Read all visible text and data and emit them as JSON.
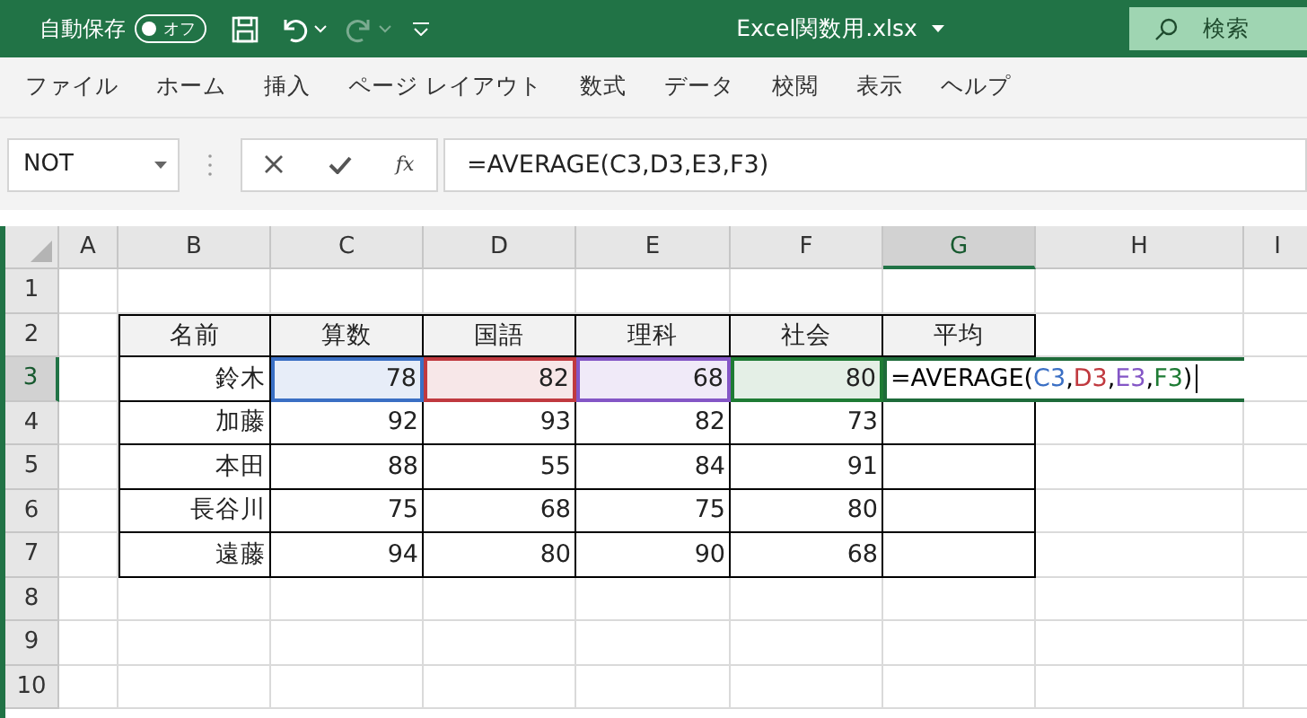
{
  "title_bar": {
    "autosave_label": "自動保存",
    "autosave_toggle": {
      "label": "オフ",
      "on": false
    },
    "redo_disabled": true,
    "file_name": "Excel関数用.xlsx",
    "search": {
      "placeholder": "検索"
    }
  },
  "menu": [
    "ファイル",
    "ホーム",
    "挿入",
    "ページ レイアウト",
    "数式",
    "データ",
    "校閲",
    "表示",
    "ヘルプ"
  ],
  "formula_bar": {
    "name_box": "NOT",
    "function_button": "fx",
    "formula": "=AVERAGE(C3,D3,E3,F3)"
  },
  "sheet": {
    "columns": [
      {
        "label": "A",
        "selected": false
      },
      {
        "label": "B",
        "selected": false
      },
      {
        "label": "C",
        "selected": false
      },
      {
        "label": "D",
        "selected": false
      },
      {
        "label": "E",
        "selected": false
      },
      {
        "label": "F",
        "selected": false
      },
      {
        "label": "G",
        "selected": true
      },
      {
        "label": "H",
        "selected": false
      },
      {
        "label": "I",
        "selected": false
      }
    ],
    "rows": [
      {
        "label": "1",
        "selected": false
      },
      {
        "label": "2",
        "selected": false
      },
      {
        "label": "3",
        "selected": true
      },
      {
        "label": "4",
        "selected": false
      },
      {
        "label": "5",
        "selected": false
      },
      {
        "label": "6",
        "selected": false
      },
      {
        "label": "7",
        "selected": false
      },
      {
        "label": "8",
        "selected": false
      },
      {
        "label": "9",
        "selected": false
      },
      {
        "label": "10",
        "selected": false
      }
    ],
    "table": {
      "header": [
        "名前",
        "算数",
        "国語",
        "理科",
        "社会",
        "平均"
      ],
      "rows": [
        {
          "cells": [
            {
              "text": "鈴木"
            },
            {
              "text": "78",
              "color": "#3a6fc4"
            },
            {
              "text": "82",
              "color": "#c0393f"
            },
            {
              "text": "68",
              "color": "#8456c6"
            },
            {
              "text": "80",
              "color": "#1e7b34"
            },
            {
              "kind": "editing",
              "tokens": [
                {
                  "text": "=AVERAGE(",
                  "color": "#000000"
                },
                {
                  "text": "C3",
                  "color": "#3a6fc4"
                },
                {
                  "text": ",",
                  "color": "#000000"
                },
                {
                  "text": "D3",
                  "color": "#c0393f"
                },
                {
                  "text": ",",
                  "color": "#000000"
                },
                {
                  "text": "E3",
                  "color": "#8456c6"
                },
                {
                  "text": ",",
                  "color": "#000000"
                },
                {
                  "text": "F3",
                  "color": "#1e7b34"
                },
                {
                  "text": ")",
                  "color": "#000000"
                }
              ]
            }
          ]
        },
        {
          "cells": [
            {
              "text": "加藤"
            },
            {
              "text": "92"
            },
            {
              "text": "93"
            },
            {
              "text": "82"
            },
            {
              "text": "73"
            }
          ]
        },
        {
          "cells": [
            {
              "text": "本田"
            },
            {
              "text": "88"
            },
            {
              "text": "55"
            },
            {
              "text": "84"
            },
            {
              "text": "91"
            }
          ]
        },
        {
          "cells": [
            {
              "text": "長谷川"
            },
            {
              "text": "75"
            },
            {
              "text": "68"
            },
            {
              "text": "75"
            },
            {
              "text": "80"
            }
          ]
        },
        {
          "cells": [
            {
              "text": "遠藤"
            },
            {
              "text": "94"
            },
            {
              "text": "80"
            },
            {
              "text": "90"
            },
            {
              "text": "68"
            }
          ]
        }
      ]
    }
  }
}
